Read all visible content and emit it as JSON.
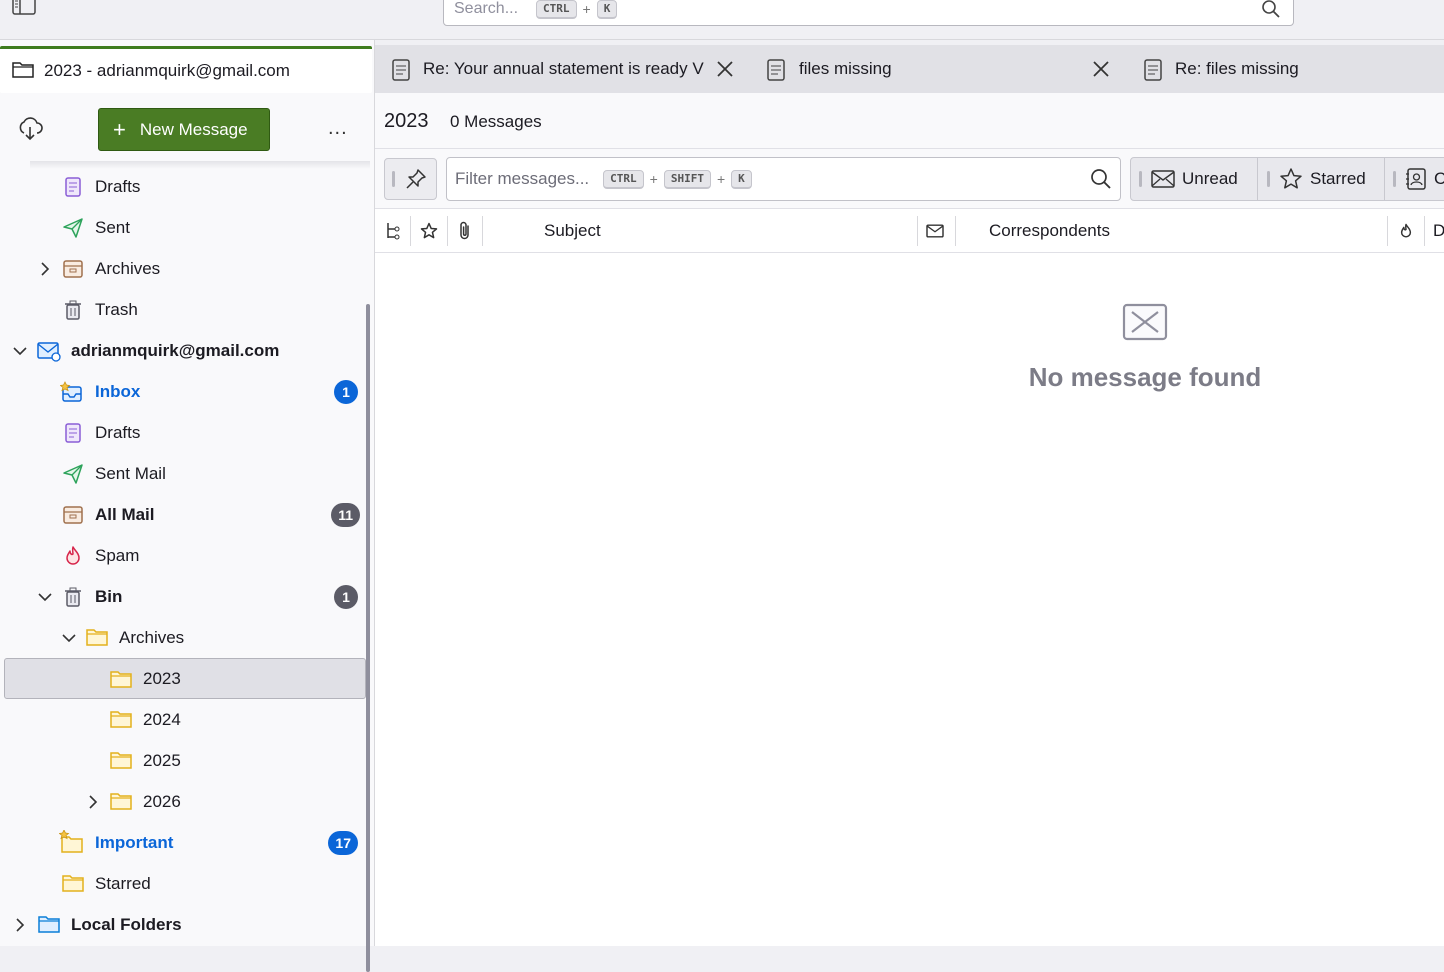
{
  "global_search": {
    "placeholder": "Search...",
    "key1": "CTRL",
    "plus": "+",
    "key2": "K"
  },
  "sidebar": {
    "header": "2023 - adrianmquirk@gmail.com",
    "new_message": "New Message",
    "more": "...",
    "items": [
      {
        "label": "Drafts"
      },
      {
        "label": "Sent"
      },
      {
        "label": "Archives"
      },
      {
        "label": "Trash"
      },
      {
        "label": "adrianmquirk@gmail.com"
      },
      {
        "label": "Inbox",
        "badge": "1"
      },
      {
        "label": "Drafts"
      },
      {
        "label": "Sent Mail"
      },
      {
        "label": "All Mail",
        "badge": "11"
      },
      {
        "label": "Spam"
      },
      {
        "label": "Bin",
        "badge": "1"
      },
      {
        "label": "Archives"
      },
      {
        "label": "2023"
      },
      {
        "label": "2024"
      },
      {
        "label": "2025"
      },
      {
        "label": "2026"
      },
      {
        "label": "Important",
        "badge": "17"
      },
      {
        "label": "Starred"
      },
      {
        "label": "Local Folders"
      }
    ]
  },
  "tabs": [
    {
      "label": "Re: Your annual statement is ready V"
    },
    {
      "label": "files missing"
    },
    {
      "label": "Re: files missing"
    }
  ],
  "main": {
    "folder_name": "2023",
    "message_count": "0 Messages",
    "filter": {
      "placeholder": "Filter messages...",
      "key1": "CTRL",
      "plus": "+",
      "key2": "SHIFT",
      "key3": "K"
    },
    "quick_filters": {
      "unread": "Unread",
      "starred": "Starred",
      "contacts": "C"
    },
    "columns": {
      "subject": "Subject",
      "correspondents": "Correspondents",
      "date": "D"
    },
    "empty_text": "No message found"
  },
  "colors": {
    "accent_green": "#4a7c24",
    "badge_blue": "#0b66d8",
    "folder_yellow": "#f5c342"
  }
}
